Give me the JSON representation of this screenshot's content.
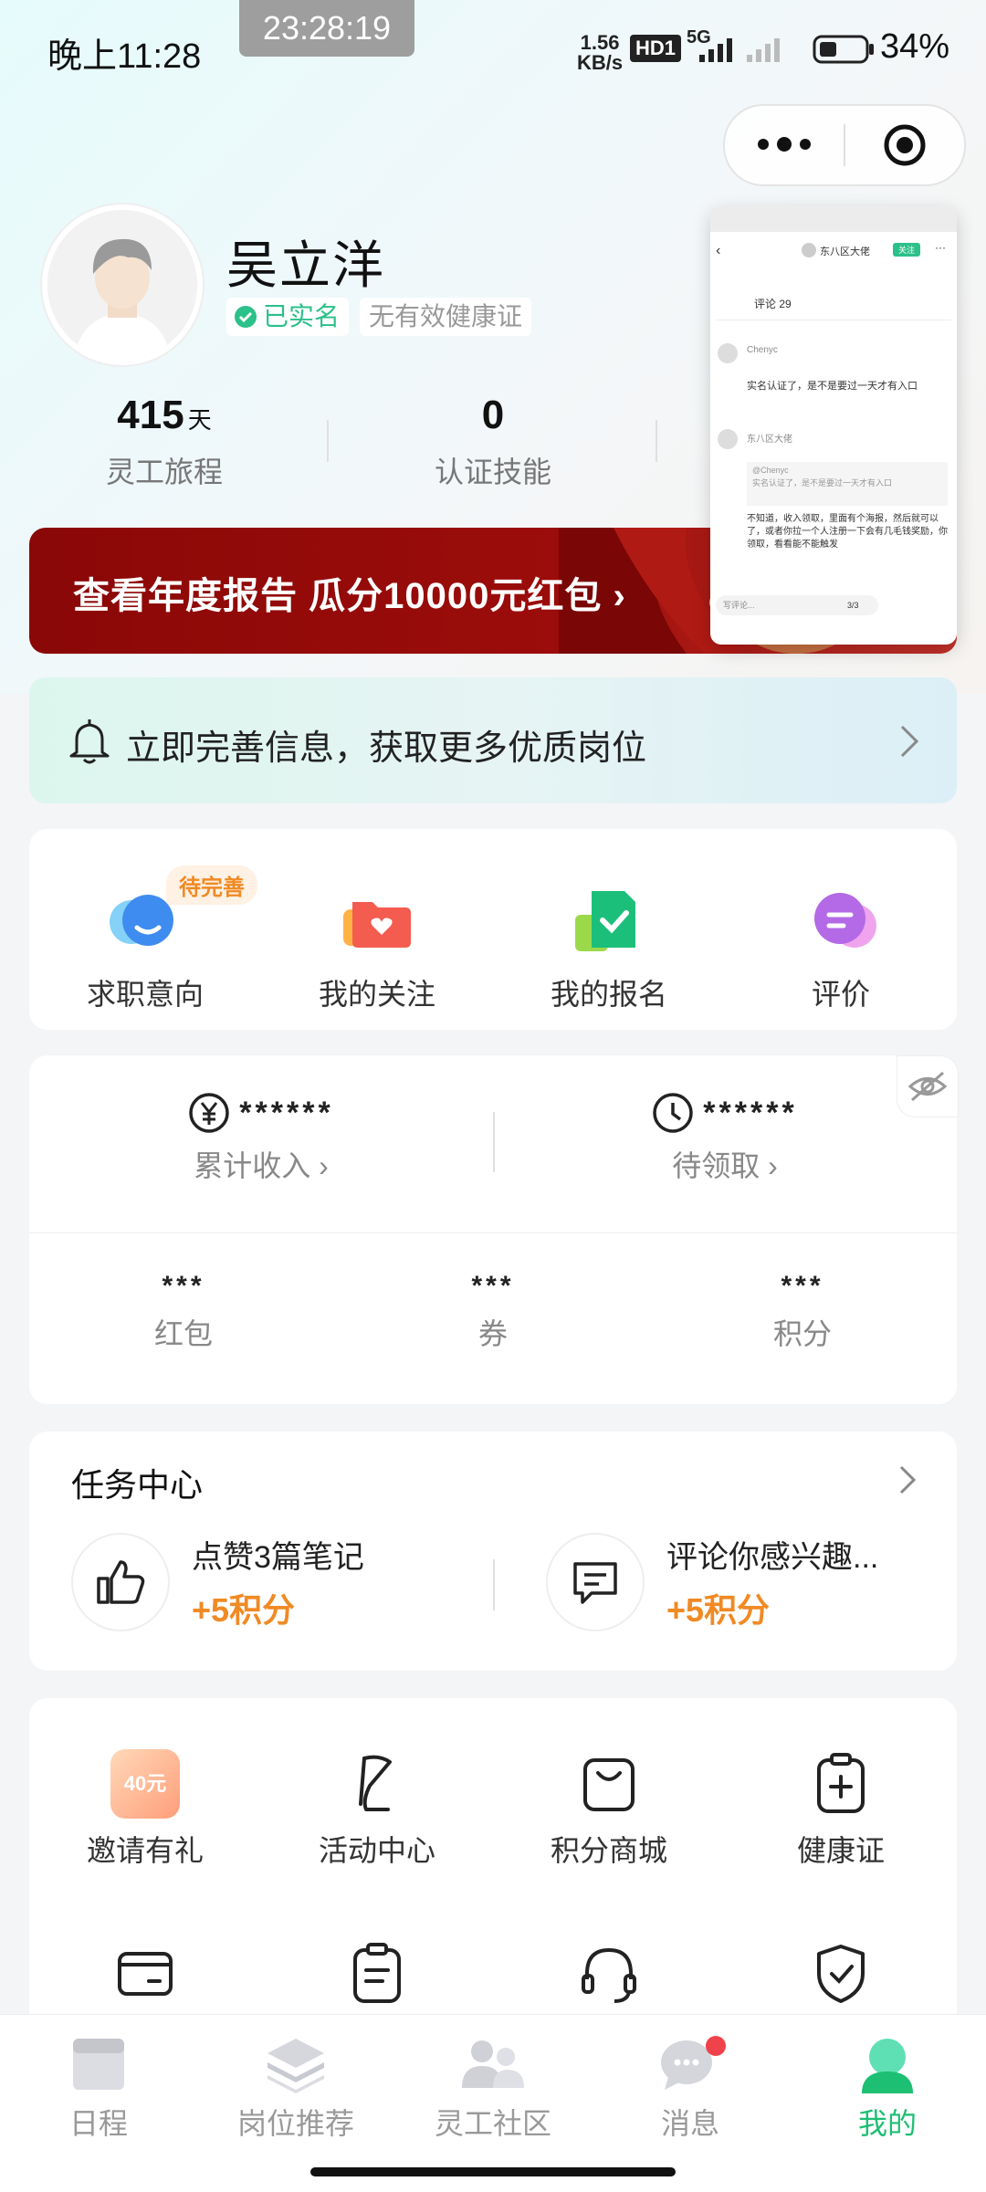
{
  "status_bar": {
    "time": "晚上11:28",
    "clock": "23:28:19",
    "net_speed_value": "1.56",
    "net_speed_unit": "KB/s",
    "hd": "HD1",
    "network": "5G",
    "battery": "34%"
  },
  "profile": {
    "name": "吴立洋",
    "verified": "已实名",
    "health_cert_status": "无有效健康证",
    "stats": [
      {
        "value": "415",
        "unit": "天",
        "label": "灵工旅程"
      },
      {
        "value": "0",
        "unit": "",
        "label": "认证技能"
      }
    ]
  },
  "banner": {
    "text": "查看年度报告  瓜分10000元红包"
  },
  "preview": {
    "header": "东八区大佬",
    "header_btn": "关注",
    "comments_title": "评论 29",
    "c1_name": "Chenyc",
    "c1_text": "实名认证了，是不是要过一天才有入口",
    "c2_name": "东八区大佬",
    "c2_quote": "@Chenyc",
    "c2_quote_text": "实名认证了，是不是要过一天才有入口",
    "c2_text": "不知道，收入领取，里面有个海报，然后就可以了，或者你拉一个人注册一下会有几毛钱奖励，你领取，看看能不能触发",
    "input_placeholder": "写评论...",
    "page_count": "3/3"
  },
  "notice": {
    "text": "立即完善信息，获取更多优质岗位"
  },
  "quick_actions": {
    "pending_tag": "待完善",
    "items": [
      {
        "label": "求职意向",
        "icon": "job-intent-icon"
      },
      {
        "label": "我的关注",
        "icon": "favorites-folder-icon"
      },
      {
        "label": "我的报名",
        "icon": "registration-doc-icon"
      },
      {
        "label": "评价",
        "icon": "review-chat-icon"
      }
    ]
  },
  "wallet": {
    "total_income_value": "******",
    "total_income_label": "累计收入",
    "pending_value": "******",
    "pending_label": "待领取",
    "mini": [
      {
        "value": "***",
        "label": "红包"
      },
      {
        "value": "***",
        "label": "券"
      },
      {
        "value": "***",
        "label": "积分"
      }
    ]
  },
  "tasks": {
    "title": "任务中心",
    "items": [
      {
        "name": "点赞3篇笔记",
        "points": "+5积分"
      },
      {
        "name": "评论你感兴趣...",
        "points": "+5积分"
      }
    ]
  },
  "tools": {
    "invite_badge": "40元",
    "items": [
      {
        "label": "邀请有礼"
      },
      {
        "label": "活动中心"
      },
      {
        "label": "积分商城"
      },
      {
        "label": "健康证"
      }
    ]
  },
  "tabbar": {
    "items": [
      {
        "label": "日程"
      },
      {
        "label": "岗位推荐"
      },
      {
        "label": "灵工社区"
      },
      {
        "label": "消息"
      },
      {
        "label": "我的"
      }
    ]
  },
  "colors": {
    "accent_green": "#1dbf73",
    "points_orange": "#f08a24",
    "banner_red": "#8a0808"
  }
}
